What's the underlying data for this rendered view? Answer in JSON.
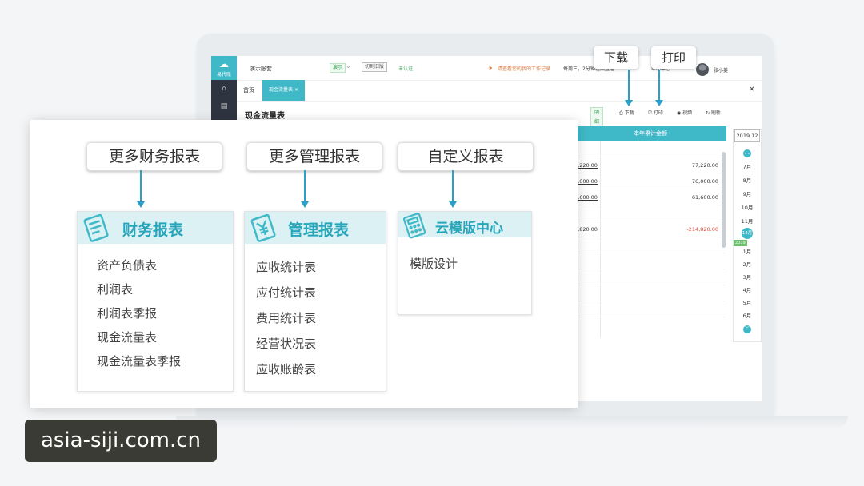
{
  "app": {
    "account_name": "演示账套",
    "demo_badge": "演示",
    "switch_label": "切到旧版",
    "unverified_label": "未认证",
    "notice": "请查看您的我的工作记录",
    "weekly": "每周三，2分钟视频直播",
    "help_link": "帮助中心",
    "username": "张小姜",
    "logo_text": "易代账"
  },
  "tabs": {
    "home": "首页",
    "active": "现金流量表",
    "active_close": "×",
    "close_all": "×"
  },
  "page": {
    "title": "现金流量表"
  },
  "toolbar": {
    "detail": "明细",
    "download": "下载",
    "print": "打印",
    "video": "视频",
    "refresh": "刷新"
  },
  "callouts": {
    "download": "下载",
    "print": "打印"
  },
  "table": {
    "header": "本年累计金额",
    "rows": [
      {
        "left": "",
        "right": ""
      },
      {
        "left": "7,220.00",
        "right": "77,220.00"
      },
      {
        "left": "6,000.00",
        "right": "76,000.00"
      },
      {
        "left": "1,600.00",
        "right": "61,600.00"
      },
      {
        "left": "",
        "right": ""
      },
      {
        "left": "4,820.00",
        "right": "-214,820.00",
        "negative": true
      }
    ]
  },
  "month_picker": {
    "year": "2019.12",
    "months_before": [
      "7月",
      "8月",
      "9月",
      "10月",
      "11月"
    ],
    "selected": "12月",
    "year_tag": "2019",
    "months_after": [
      "1月",
      "2月",
      "3月",
      "4月",
      "5月",
      "6月"
    ]
  },
  "overlay": {
    "callouts": [
      "更多财务报表",
      "更多管理报表",
      "自定义报表"
    ],
    "cards": [
      {
        "title": "财务报表",
        "icon": "document-icon",
        "items": [
          "资产负债表",
          "利润表",
          "利润表季报",
          "现金流量表",
          "现金流量表季报"
        ]
      },
      {
        "title": "管理报表",
        "icon": "currency-icon",
        "items": [
          "应收统计表",
          "应付统计表",
          "费用统计表",
          "经营状况表",
          "应收账龄表"
        ]
      },
      {
        "title": "云模版中心",
        "icon": "calculator-icon",
        "items": [
          "模版设计"
        ]
      }
    ]
  },
  "watermark": "asia-siji.com.cn",
  "colors": {
    "accent": "#3fb9c8",
    "arrow": "#2a9fc7",
    "card_head": "#dcf1f4",
    "negative": "#e04a3a"
  }
}
